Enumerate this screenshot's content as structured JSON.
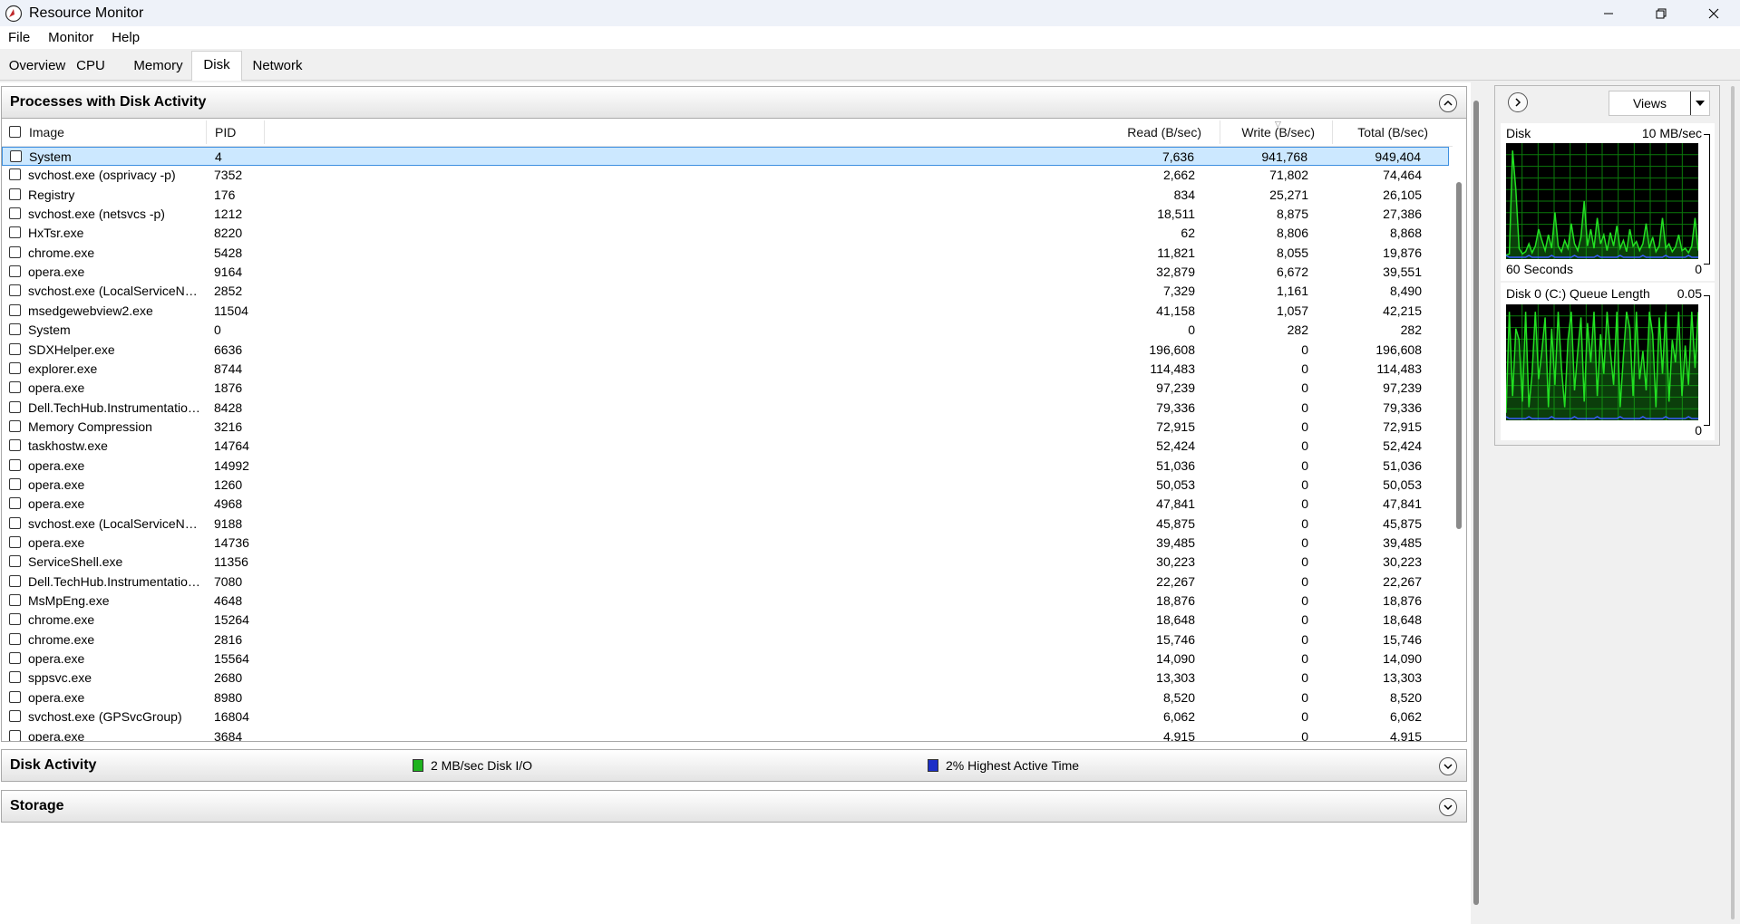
{
  "window": {
    "title": "Resource Monitor"
  },
  "menu": [
    "File",
    "Monitor",
    "Help"
  ],
  "tabs": [
    "Overview",
    "CPU",
    "Memory",
    "Disk",
    "Network"
  ],
  "active_tab": "Disk",
  "processes": {
    "title": "Processes with Disk Activity",
    "columns": {
      "image": "Image",
      "pid": "PID",
      "read": "Read (B/sec)",
      "write": "Write (B/sec)",
      "total": "Total (B/sec)"
    },
    "rows": [
      {
        "image": "System",
        "pid": "4",
        "read": "7,636",
        "write": "941,768",
        "total": "949,404"
      },
      {
        "image": "svchost.exe (osprivacy -p)",
        "pid": "7352",
        "read": "2,662",
        "write": "71,802",
        "total": "74,464"
      },
      {
        "image": "Registry",
        "pid": "176",
        "read": "834",
        "write": "25,271",
        "total": "26,105"
      },
      {
        "image": "svchost.exe (netsvcs -p)",
        "pid": "1212",
        "read": "18,511",
        "write": "8,875",
        "total": "27,386"
      },
      {
        "image": "HxTsr.exe",
        "pid": "8220",
        "read": "62",
        "write": "8,806",
        "total": "8,868"
      },
      {
        "image": "chrome.exe",
        "pid": "5428",
        "read": "11,821",
        "write": "8,055",
        "total": "19,876"
      },
      {
        "image": "opera.exe",
        "pid": "9164",
        "read": "32,879",
        "write": "6,672",
        "total": "39,551"
      },
      {
        "image": "svchost.exe (LocalServiceNetwo...",
        "pid": "2852",
        "read": "7,329",
        "write": "1,161",
        "total": "8,490"
      },
      {
        "image": "msedgewebview2.exe",
        "pid": "11504",
        "read": "41,158",
        "write": "1,057",
        "total": "42,215"
      },
      {
        "image": "System",
        "pid": "0",
        "read": "0",
        "write": "282",
        "total": "282"
      },
      {
        "image": "SDXHelper.exe",
        "pid": "6636",
        "read": "196,608",
        "write": "0",
        "total": "196,608"
      },
      {
        "image": "explorer.exe",
        "pid": "8744",
        "read": "114,483",
        "write": "0",
        "total": "114,483"
      },
      {
        "image": "opera.exe",
        "pid": "1876",
        "read": "97,239",
        "write": "0",
        "total": "97,239"
      },
      {
        "image": "Dell.TechHub.Instrumentation.U...",
        "pid": "8428",
        "read": "79,336",
        "write": "0",
        "total": "79,336"
      },
      {
        "image": "Memory Compression",
        "pid": "3216",
        "read": "72,915",
        "write": "0",
        "total": "72,915"
      },
      {
        "image": "taskhostw.exe",
        "pid": "14764",
        "read": "52,424",
        "write": "0",
        "total": "52,424"
      },
      {
        "image": "opera.exe",
        "pid": "14992",
        "read": "51,036",
        "write": "0",
        "total": "51,036"
      },
      {
        "image": "opera.exe",
        "pid": "1260",
        "read": "50,053",
        "write": "0",
        "total": "50,053"
      },
      {
        "image": "opera.exe",
        "pid": "4968",
        "read": "47,841",
        "write": "0",
        "total": "47,841"
      },
      {
        "image": "svchost.exe (LocalServiceNetwo...",
        "pid": "9188",
        "read": "45,875",
        "write": "0",
        "total": "45,875"
      },
      {
        "image": "opera.exe",
        "pid": "14736",
        "read": "39,485",
        "write": "0",
        "total": "39,485"
      },
      {
        "image": "ServiceShell.exe",
        "pid": "11356",
        "read": "30,223",
        "write": "0",
        "total": "30,223"
      },
      {
        "image": "Dell.TechHub.Instrumentation.S...",
        "pid": "7080",
        "read": "22,267",
        "write": "0",
        "total": "22,267"
      },
      {
        "image": "MsMpEng.exe",
        "pid": "4648",
        "read": "18,876",
        "write": "0",
        "total": "18,876"
      },
      {
        "image": "chrome.exe",
        "pid": "15264",
        "read": "18,648",
        "write": "0",
        "total": "18,648"
      },
      {
        "image": "chrome.exe",
        "pid": "2816",
        "read": "15,746",
        "write": "0",
        "total": "15,746"
      },
      {
        "image": "opera.exe",
        "pid": "15564",
        "read": "14,090",
        "write": "0",
        "total": "14,090"
      },
      {
        "image": "sppsvc.exe",
        "pid": "2680",
        "read": "13,303",
        "write": "0",
        "total": "13,303"
      },
      {
        "image": "opera.exe",
        "pid": "8980",
        "read": "8,520",
        "write": "0",
        "total": "8,520"
      },
      {
        "image": "svchost.exe (GPSvcGroup)",
        "pid": "16804",
        "read": "6,062",
        "write": "0",
        "total": "6,062"
      },
      {
        "image": "opera.exe",
        "pid": "3684",
        "read": "4,915",
        "write": "0",
        "total": "4,915"
      }
    ]
  },
  "disk_activity": {
    "title": "Disk Activity",
    "io_label": "2 MB/sec Disk I/O",
    "active_label": "2% Highest Active Time",
    "io_color": "#1fb31f",
    "active_color": "#1c2fc8"
  },
  "storage": {
    "title": "Storage"
  },
  "right_panel": {
    "views_label": "Views",
    "graph1": {
      "title": "Disk",
      "max_label": "10 MB/sec",
      "time_label": "60 Seconds",
      "min_label": "0",
      "series": [
        2,
        3,
        95,
        60,
        8,
        3,
        5,
        12,
        4,
        10,
        25,
        15,
        6,
        20,
        8,
        40,
        10,
        5,
        15,
        8,
        30,
        12,
        6,
        18,
        50,
        10,
        25,
        8,
        35,
        12,
        20,
        6,
        22,
        10,
        28,
        8,
        15,
        5,
        25,
        10,
        14,
        6,
        12,
        30,
        8,
        18,
        5,
        10,
        35,
        8,
        12,
        5,
        9,
        20,
        6,
        8,
        4,
        10,
        35,
        6
      ]
    },
    "graph2": {
      "title": "Disk 0 (C:) Queue Length",
      "max_label": "0.05",
      "min_label": "0",
      "series": [
        5,
        95,
        20,
        80,
        70,
        15,
        95,
        10,
        40,
        95,
        35,
        60,
        90,
        10,
        80,
        30,
        95,
        45,
        10,
        70,
        95,
        25,
        60,
        90,
        15,
        85,
        50,
        95,
        20,
        75,
        40,
        95,
        60,
        30,
        95,
        10,
        55,
        95,
        80,
        20,
        95,
        35,
        60,
        25,
        95,
        75,
        10,
        90,
        40,
        95,
        15,
        70,
        50,
        95,
        20,
        65,
        30,
        95,
        45,
        95
      ]
    }
  }
}
